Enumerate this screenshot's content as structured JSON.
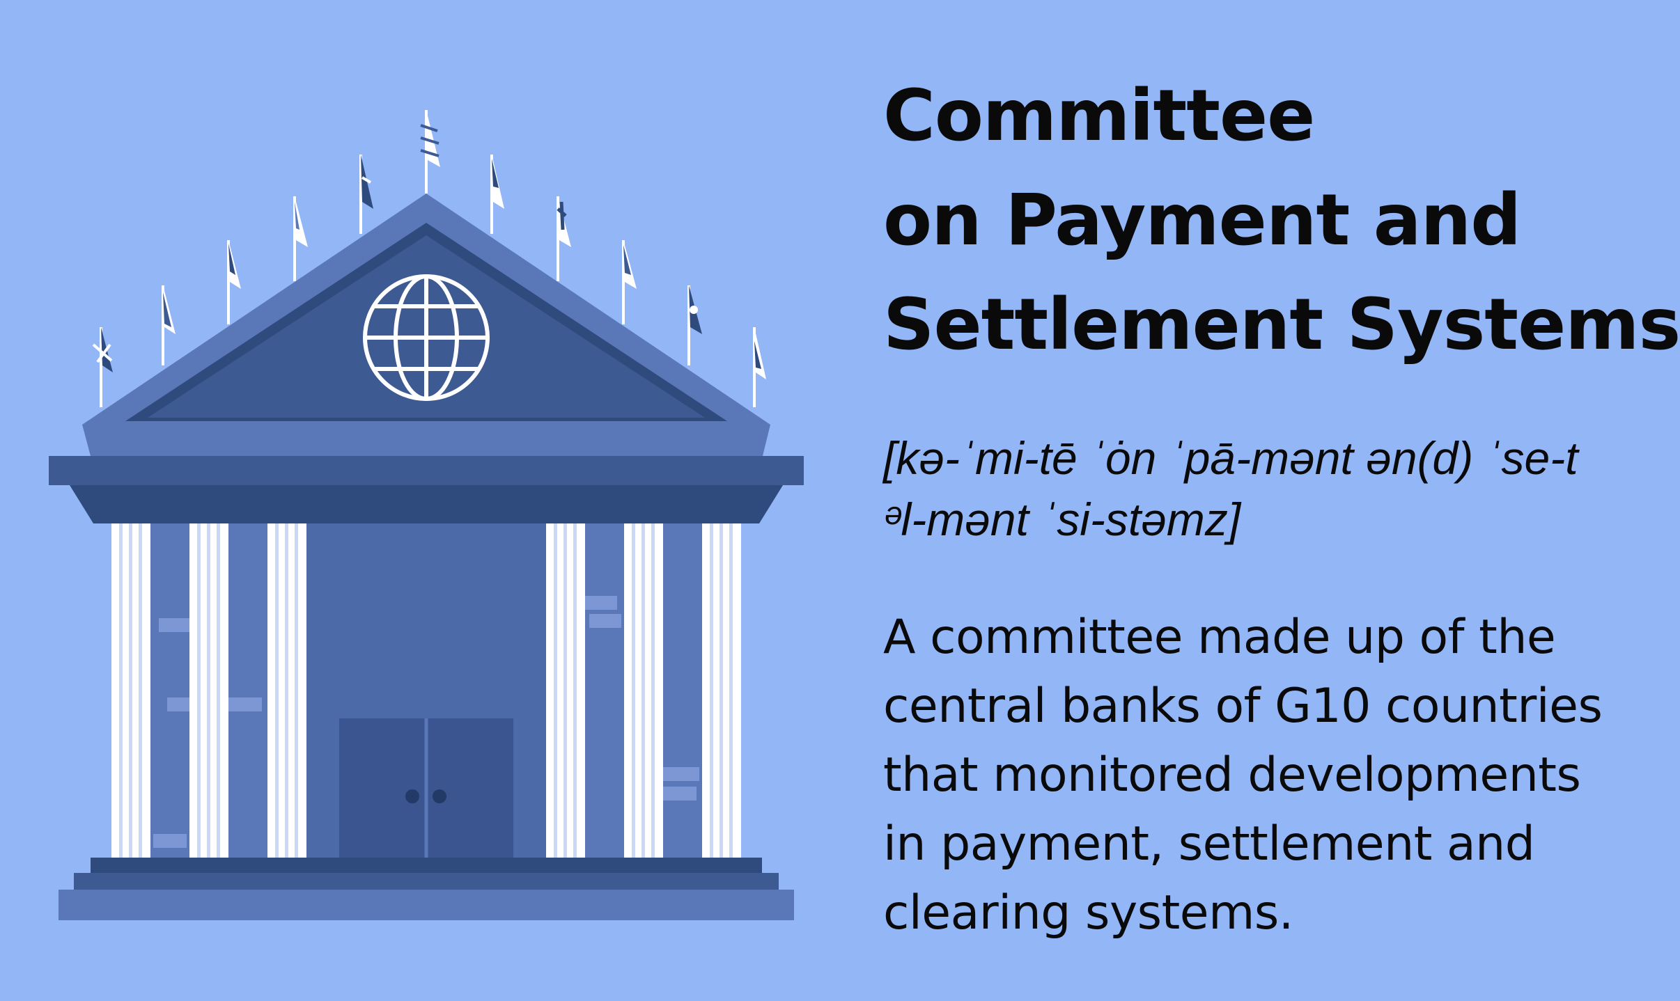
{
  "term": {
    "lines": [
      "Committee",
      "on Payment and",
      "Settlement Systems"
    ]
  },
  "pronunciation": {
    "lines": [
      "[kə-ˈmi-tē ˈȯn ˈpā-mənt ən(d) ˈse-t",
      "ᵊl-mənt ˈsi-stəmz]"
    ]
  },
  "definition": {
    "lines": [
      "A committee made up of the",
      "central banks of G10 countries",
      "that monitored developments",
      "in payment, settlement and",
      "clearing systems."
    ]
  },
  "colors": {
    "background": "#93b6f7",
    "building_dark": "#2f4a7d",
    "building_mid": "#3e5a92",
    "building_light": "#5a78b8",
    "column": "#ffffff",
    "text": "#0a0a0a"
  },
  "illustration": {
    "building": "bank-building-icon",
    "emblem": "globe-icon",
    "flags": "flag-icon",
    "door": "double-door-icon"
  }
}
